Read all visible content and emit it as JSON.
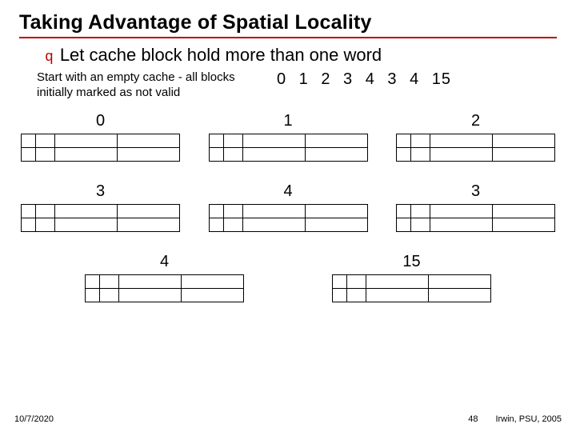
{
  "title": "Taking Advantage of Spatial Locality",
  "bullet": {
    "mark": "q",
    "text": "Let cache block hold more than one word"
  },
  "intro": "Start with an empty cache - all blocks initially marked as not valid",
  "sequence": "0  1  2  3  4  3  4  15",
  "blocks": {
    "r1": [
      {
        "label": "0"
      },
      {
        "label": "1"
      },
      {
        "label": "2"
      }
    ],
    "r2": [
      {
        "label": "3"
      },
      {
        "label": "4"
      },
      {
        "label": "3"
      }
    ],
    "r3": [
      {
        "label": "4"
      },
      {
        "label": "15"
      }
    ]
  },
  "footer": {
    "date": "10/7/2020",
    "page": "48",
    "attr": "Irwin, PSU, 2005"
  }
}
